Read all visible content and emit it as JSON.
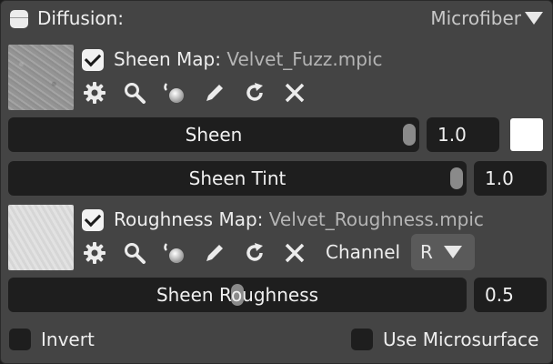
{
  "header": {
    "title": "Diffusion:",
    "preset": "Microfiber"
  },
  "sheen_map": {
    "label": "Sheen Map:",
    "file": "Velvet_Fuzz.mpic",
    "checked": true
  },
  "roughness_map": {
    "label": "Roughness Map:",
    "file": "Velvet_Roughness.mpic",
    "checked": true,
    "channel_label": "Channel",
    "channel_value": "R"
  },
  "icons": [
    "gear-icon",
    "magnifier-icon",
    "pick-material-icon",
    "pencil-icon",
    "reload-icon",
    "close-icon"
  ],
  "sliders": {
    "sheen": {
      "label": "Sheen",
      "value": "1.0",
      "level": 1.0
    },
    "sheen_tint": {
      "label": "Sheen Tint",
      "value": "1.0",
      "level": 1.0
    },
    "sheen_roughness": {
      "label": "Sheen Roughness",
      "value": "0.5",
      "level": 0.5
    }
  },
  "sheen_color": "#ffffff",
  "options": {
    "invert": {
      "label": "Invert",
      "checked": false
    },
    "use_microsurface": {
      "label": "Use Microsurface",
      "checked": false
    }
  }
}
